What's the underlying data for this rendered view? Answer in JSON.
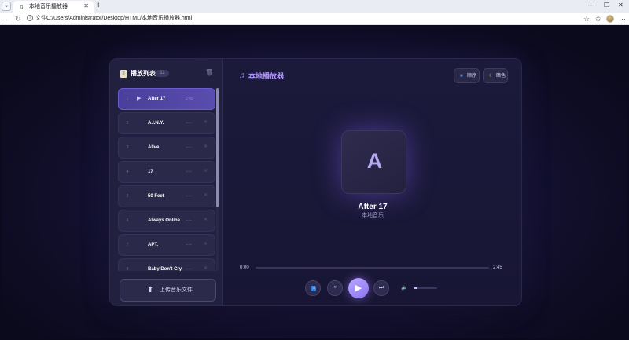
{
  "browser": {
    "tab_title": "本地音乐播放器",
    "tab_icon": "music-note-icon",
    "new_tab_glyph": "+",
    "address_prefix": "文件",
    "url": "C:/Users/Administrator/Desktop/HTML/本地音乐播放器.html"
  },
  "playlist": {
    "title": "播放列表",
    "count": "11",
    "tracks": [
      {
        "num": "1",
        "name": "After 17",
        "duration": "2:45",
        "active": true
      },
      {
        "num": "2",
        "name": "A.I.N.Y.",
        "duration": "--:--",
        "active": false
      },
      {
        "num": "3",
        "name": "Alive",
        "duration": "--:--",
        "active": false
      },
      {
        "num": "4",
        "name": "17",
        "duration": "--:--",
        "active": false
      },
      {
        "num": "5",
        "name": "50 Feet",
        "duration": "--:--",
        "active": false
      },
      {
        "num": "6",
        "name": "Always Online",
        "duration": "--:--",
        "active": false
      },
      {
        "num": "7",
        "name": "APT.",
        "duration": "--:--",
        "active": false
      },
      {
        "num": "8",
        "name": "Baby Don't Cry",
        "duration": "--:--",
        "active": false
      }
    ],
    "upload_label": "上传音乐文件"
  },
  "header": {
    "app_title": "本地播放器",
    "order_label": "顺序",
    "theme_label": "暗色"
  },
  "now_playing": {
    "cover_letter": "A",
    "title": "After 17",
    "artist": "本地音乐"
  },
  "progress": {
    "current": "0:00",
    "total": "2:45",
    "fraction": 0.0
  },
  "volume": {
    "fraction": 0.15
  },
  "colors": {
    "accent": "#8f7cff",
    "background": "#0b0a1c",
    "panel": "#1a1737"
  }
}
